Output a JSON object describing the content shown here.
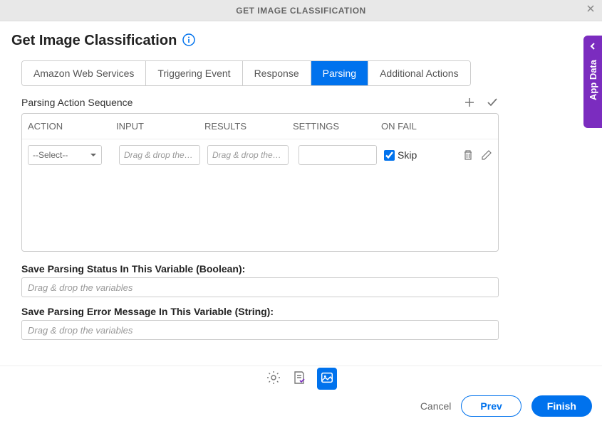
{
  "header": {
    "title": "GET IMAGE CLASSIFICATION"
  },
  "page": {
    "title": "Get Image Classification"
  },
  "tabs": [
    {
      "label": "Amazon Web Services",
      "active": false
    },
    {
      "label": "Triggering Event",
      "active": false
    },
    {
      "label": "Response",
      "active": false
    },
    {
      "label": "Parsing",
      "active": true
    },
    {
      "label": "Additional Actions",
      "active": false
    }
  ],
  "section": {
    "label": "Parsing Action Sequence"
  },
  "columns": {
    "action": "ACTION",
    "input": "INPUT",
    "results": "RESULTS",
    "settings": "SETTINGS",
    "onfail": "ON FAIL"
  },
  "row": {
    "select_placeholder": "--Select--",
    "dragdrop_placeholder": "Drag & drop the v...",
    "skip_label": "Skip",
    "skip_checked": true
  },
  "fields": {
    "status_label": "Save Parsing Status In This Variable (Boolean):",
    "status_placeholder": "Drag & drop the variables",
    "error_label": "Save Parsing Error Message In This Variable (String):",
    "error_placeholder": "Drag & drop the variables"
  },
  "footer": {
    "cancel": "Cancel",
    "prev": "Prev",
    "finish": "Finish"
  },
  "appdata": {
    "label": "App Data"
  }
}
